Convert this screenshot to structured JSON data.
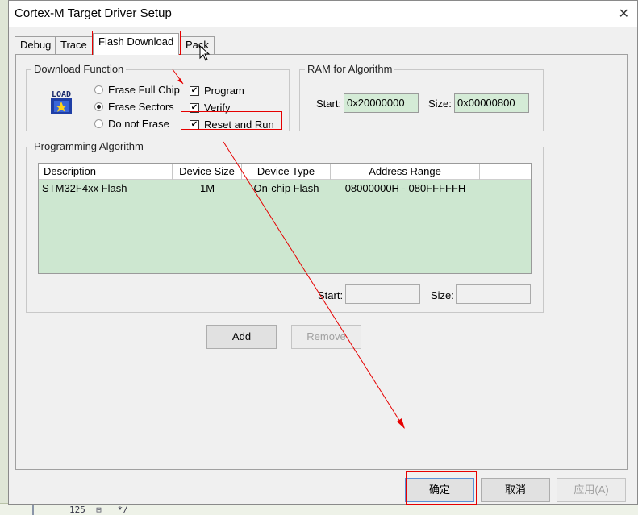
{
  "background": {
    "code_line_number": "125",
    "code_text": "*/"
  },
  "window": {
    "title": "Cortex-M Target Driver Setup",
    "close_glyph": "✕"
  },
  "tabs": [
    {
      "label": "Debug"
    },
    {
      "label": "Trace"
    },
    {
      "label": "Flash Download"
    },
    {
      "label": "Pack"
    }
  ],
  "download_function": {
    "legend": "Download Function",
    "icon_text": "LOAD",
    "radios": [
      {
        "label": "Erase Full Chip",
        "selected": false
      },
      {
        "label": "Erase Sectors",
        "selected": true
      },
      {
        "label": "Do not Erase",
        "selected": false
      }
    ],
    "checks": [
      {
        "label": "Program",
        "checked": true
      },
      {
        "label": "Verify",
        "checked": true
      },
      {
        "label": "Reset and Run",
        "checked": true
      }
    ],
    "check_glyph": "✔"
  },
  "ram": {
    "legend": "RAM for Algorithm",
    "start_label": "Start:",
    "start_value": "0x20000000",
    "size_label": "Size:",
    "size_value": "0x00000800"
  },
  "programming_algorithm": {
    "legend": "Programming Algorithm",
    "columns": [
      "Description",
      "Device Size",
      "Device Type",
      "Address Range"
    ],
    "rows": [
      {
        "description": "STM32F4xx Flash",
        "device_size": "1M",
        "device_type": "On-chip Flash",
        "address_range": "08000000H - 080FFFFFH"
      }
    ],
    "start_label": "Start:",
    "start_value": "",
    "size_label": "Size:",
    "size_value": ""
  },
  "buttons": {
    "add": "Add",
    "remove": "Remove",
    "ok": "确定",
    "cancel": "取消",
    "apply": "应用(A)"
  },
  "colors": {
    "annotation": "#e60000",
    "field_bg": "#d4ebd6",
    "table_bg": "#cde7d0"
  }
}
